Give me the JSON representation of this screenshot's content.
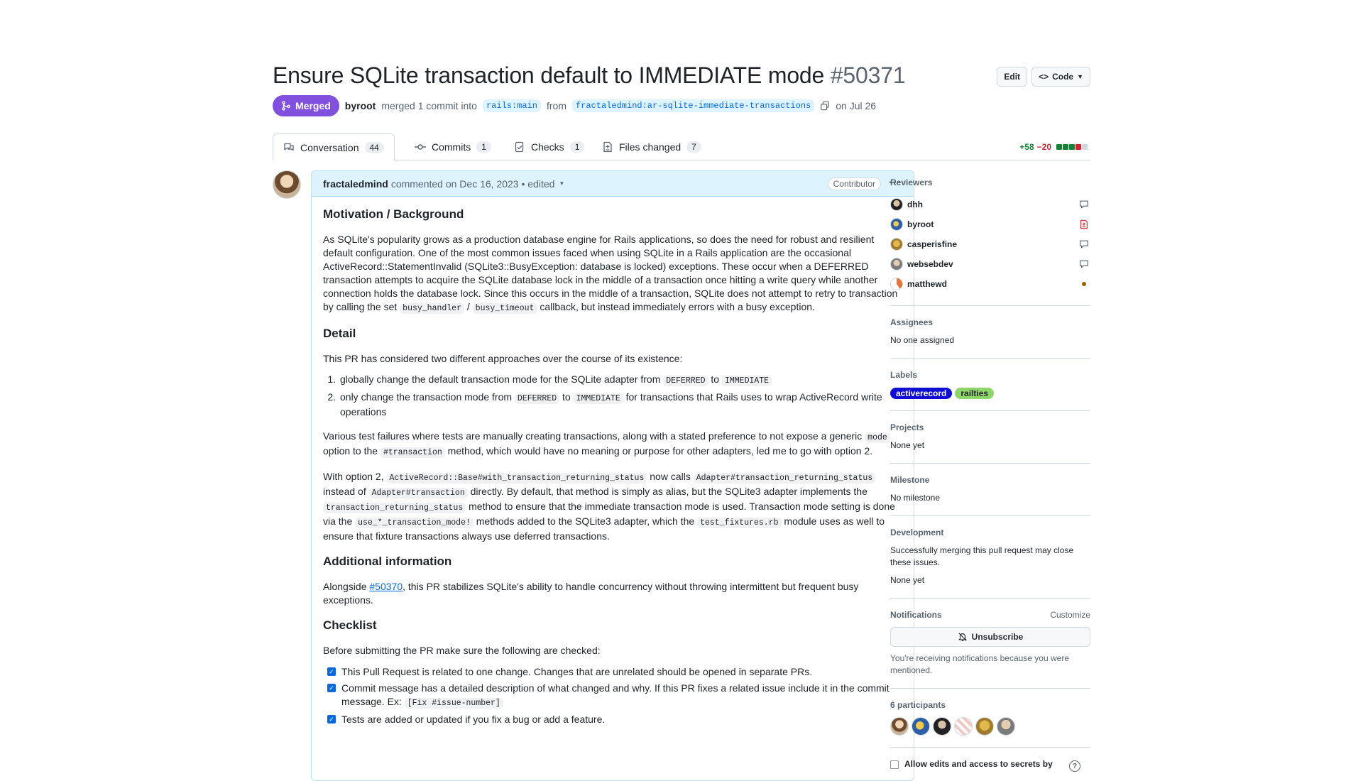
{
  "pr": {
    "title": "Ensure SQLite transaction default to IMMEDIATE mode",
    "number": "#50371",
    "edit_label": "Edit",
    "code_label": "Code",
    "status": "Merged",
    "author": "byroot",
    "merge_text": "merged 1 commit into",
    "base_branch": "rails:main",
    "from_text": "from",
    "head_branch": "fractaledmind:ar-sqlite-immediate-transactions",
    "date_text": "on Jul 26"
  },
  "tabs": [
    {
      "label": "Conversation",
      "count": "44"
    },
    {
      "label": "Commits",
      "count": "1"
    },
    {
      "label": "Checks",
      "count": "1"
    },
    {
      "label": "Files changed",
      "count": "7"
    }
  ],
  "diffstat": {
    "additions": "+58",
    "deletions": "−20"
  },
  "comment": {
    "author": "fractaledmind",
    "meta": "commented on Dec 16, 2023 • edited",
    "role": "Contributor",
    "h_motivation": "Motivation / Background",
    "p1_a": "As SQLite's popularity grows as a production database engine for Rails applications, so does the need for robust and resilient default configuration. One of the most common issues faced when using SQLite in a Rails application are the occasional ActiveRecord::StatementInvalid (SQLite3::BusyException: database is locked) exceptions. These occur when a DEFERRED transaction attempts to acquire the SQLite database lock in the middle of a transaction once hitting a write query while another connection holds the database lock. Since this occurs in the middle of a transaction, SQLite does not attempt to retry to transaction by calling the set ",
    "p1_code1": "busy_handler",
    "p1_sep": " / ",
    "p1_code2": "busy_timeout",
    "p1_b": " callback, but instead immediately errors with a busy exception.",
    "h_detail": "Detail",
    "p2": "This PR has considered two different approaches over the course of its existence:",
    "li1_a": "globally change the default transaction mode for the SQLite adapter from ",
    "li1_code1": "DEFERRED",
    "li1_b": " to ",
    "li1_code2": "IMMEDIATE",
    "li2_a": "only change the transaction mode from ",
    "li2_code1": "DEFERRED",
    "li2_b": " to ",
    "li2_code2": "IMMEDIATE",
    "li2_c": " for transactions that Rails uses to wrap ActiveRecord write operations",
    "p3_a": "Various test failures where tests are manually creating transactions, along with a stated preference to not expose a generic ",
    "p3_code1": "mode",
    "p3_b": " option to the ",
    "p3_code2": "#transaction",
    "p3_c": " method, which would have no meaning or purpose for other adapters, led me to go with option 2.",
    "p4_a": "With option 2, ",
    "p4_code1": "ActiveRecord::Base#with_transaction_returning_status",
    "p4_b": " now calls ",
    "p4_code2": "Adapter#transaction_returning_status",
    "p4_c": " instead of ",
    "p4_code3": "Adapter#transaction",
    "p4_d": " directly. By default, that method is simply as alias, but the SQLite3 adapter implements the ",
    "p4_code4": "transaction_returning_status",
    "p4_e": " method to ensure that the immediate transaction mode is used. Transaction mode setting is done via the ",
    "p4_code5": "use_*_transaction_mode!",
    "p4_f": " methods added to the SQLite3 adapter, which the ",
    "p4_code6": "test_fixtures.rb",
    "p4_g": " module uses as well to ensure that fixture transactions always use deferred transactions.",
    "h_additional": "Additional information",
    "p5_a": "Alongside ",
    "p5_link": "#50370",
    "p5_b": ", this PR stabilizes SQLite's ability to handle concurrency without throwing intermittent but frequent busy exceptions.",
    "h_checklist": "Checklist",
    "p6": "Before submitting the PR make sure the following are checked:",
    "check1": "This Pull Request is related to one change. Changes that are unrelated should be opened in separate PRs.",
    "check2_a": "Commit message has a detailed description of what changed and why. If this PR fixes a related issue include it in the commit message. Ex: ",
    "check2_code": "[Fix #issue-number]",
    "check3": "Tests are added or updated if you fix a bug or add a feature."
  },
  "sidebar": {
    "reviewers_title": "Reviewers",
    "reviewers": [
      {
        "name": "dhh"
      },
      {
        "name": "byroot"
      },
      {
        "name": "casperisfine"
      },
      {
        "name": "websebdev"
      },
      {
        "name": "matthewd"
      }
    ],
    "assignees_title": "Assignees",
    "assignees_value": "No one assigned",
    "labels_title": "Labels",
    "labels": [
      {
        "name": "activerecord",
        "bg": "#0e0ed4",
        "fg": "#ffffff"
      },
      {
        "name": "railties",
        "bg": "#8ed66a",
        "fg": "#1f2328"
      }
    ],
    "projects_title": "Projects",
    "projects_value": "None yet",
    "milestone_title": "Milestone",
    "milestone_value": "No milestone",
    "development_title": "Development",
    "development_text": "Successfully merging this pull request may close these issues.",
    "development_value": "None yet",
    "notifications_title": "Notifications",
    "customize_label": "Customize",
    "unsubscribe_label": "Unsubscribe",
    "notifications_note": "You're receiving notifications because you were mentioned.",
    "participants_title": "6 participants",
    "allow_edits_label": "Allow edits and access to secrets by"
  },
  "colors": {
    "merged": "#8250df",
    "accent": "#0969da",
    "additions": "#1a7f37",
    "deletions": "#d1242f"
  }
}
